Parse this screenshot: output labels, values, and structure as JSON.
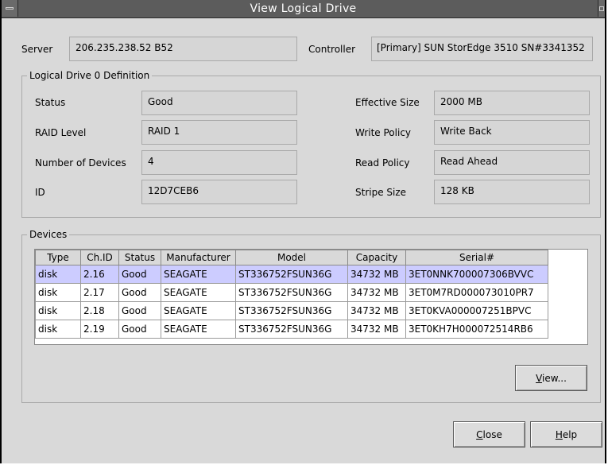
{
  "window": {
    "title": "View Logical Drive"
  },
  "server": {
    "label": "Server",
    "value": "206.235.238.52 B52"
  },
  "controller": {
    "label": "Controller",
    "value": "[Primary] SUN StorEdge 3510 SN#3341352"
  },
  "definition": {
    "group_title": "Logical Drive  0  Definition",
    "status": {
      "label": "Status",
      "value": "Good"
    },
    "raid_level": {
      "label": "RAID Level",
      "value": "RAID 1"
    },
    "num_devices": {
      "label": "Number of Devices",
      "value": "4"
    },
    "id": {
      "label": "ID",
      "value": "12D7CEB6"
    },
    "effective_size": {
      "label": "Effective Size",
      "value": "2000 MB"
    },
    "write_policy": {
      "label": "Write Policy",
      "value": "Write Back"
    },
    "read_policy": {
      "label": "Read Policy",
      "value": "Read Ahead"
    },
    "stripe_size": {
      "label": "Stripe Size",
      "value": "128 KB"
    }
  },
  "devices": {
    "group_title": "Devices",
    "columns": [
      "Type",
      "Ch.ID",
      "Status",
      "Manufacturer",
      "Model",
      "Capacity",
      "Serial#"
    ],
    "rows": [
      [
        "disk",
        "2.16",
        "Good",
        "SEAGATE",
        "ST336752FSUN36G",
        "34732 MB",
        "3ET0NNK700007306BVVC"
      ],
      [
        "disk",
        "2.17",
        "Good",
        "SEAGATE",
        "ST336752FSUN36G",
        "34732 MB",
        "3ET0M7RD000073010PR7"
      ],
      [
        "disk",
        "2.18",
        "Good",
        "SEAGATE",
        "ST336752FSUN36G",
        "34732 MB",
        "3ET0KVA000007251BPVC"
      ],
      [
        "disk",
        "2.19",
        "Good",
        "SEAGATE",
        "ST336752FSUN36G",
        "34732 MB",
        "3ET0KH7H000072514RB6"
      ]
    ],
    "selected_row": 0
  },
  "buttons": {
    "view": {
      "mnemonic": "V",
      "rest": "iew..."
    },
    "close": {
      "mnemonic": "C",
      "rest": "lose"
    },
    "help": {
      "mnemonic": "H",
      "rest": "elp"
    }
  },
  "colors": {
    "selection": "#ccccff",
    "titlebar": "#5c5c5c",
    "dialog_bg": "#d9d9d9"
  }
}
